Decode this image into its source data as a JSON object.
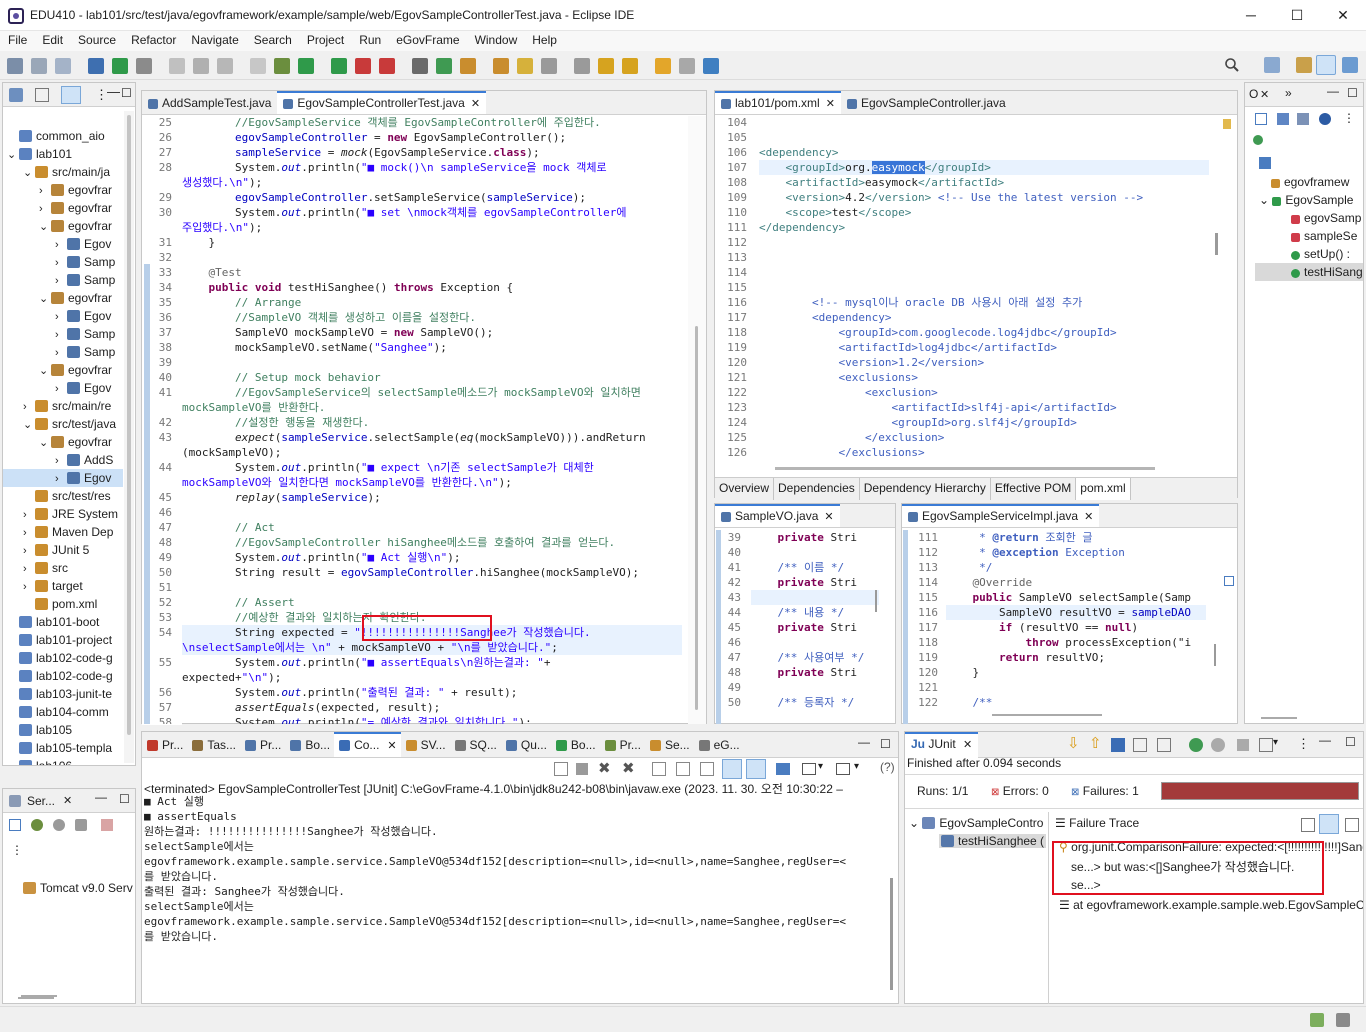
{
  "window": {
    "title": "EDU410 - lab101/src/test/java/egovframework/example/sample/web/EgovSampleControllerTest.java - Eclipse IDE",
    "minimize": "─",
    "maximize": "☐",
    "close": "✕"
  },
  "menu": [
    "File",
    "Edit",
    "Source",
    "Refactor",
    "Navigate",
    "Search",
    "Project",
    "Run",
    "eGovFrame",
    "Window",
    "Help"
  ],
  "explorer": {
    "items": [
      {
        "label": "common_aio",
        "indent": 0,
        "arrow": ""
      },
      {
        "label": "lab101",
        "indent": 0,
        "arrow": "⌄"
      },
      {
        "label": "src/main/ja",
        "indent": 1,
        "arrow": "⌄"
      },
      {
        "label": "egovfrar",
        "indent": 2,
        "arrow": "›"
      },
      {
        "label": "egovfrar",
        "indent": 2,
        "arrow": "›"
      },
      {
        "label": "egovfrar",
        "indent": 2,
        "arrow": "⌄"
      },
      {
        "label": "Egov",
        "indent": 3,
        "arrow": "›"
      },
      {
        "label": "Samp",
        "indent": 3,
        "arrow": "›"
      },
      {
        "label": "Samp",
        "indent": 3,
        "arrow": "›"
      },
      {
        "label": "egovfrar",
        "indent": 2,
        "arrow": "⌄"
      },
      {
        "label": "Egov",
        "indent": 3,
        "arrow": "›"
      },
      {
        "label": "Samp",
        "indent": 3,
        "arrow": "›"
      },
      {
        "label": "Samp",
        "indent": 3,
        "arrow": "›"
      },
      {
        "label": "egovfrar",
        "indent": 2,
        "arrow": "⌄"
      },
      {
        "label": "Egov",
        "indent": 3,
        "arrow": "›"
      },
      {
        "label": "src/main/re",
        "indent": 1,
        "arrow": "›"
      },
      {
        "label": "src/test/java",
        "indent": 1,
        "arrow": "⌄"
      },
      {
        "label": "egovfrar",
        "indent": 2,
        "arrow": "⌄"
      },
      {
        "label": "AddS",
        "indent": 3,
        "arrow": "›"
      },
      {
        "label": "Egov",
        "indent": 3,
        "arrow": "›"
      },
      {
        "label": "src/test/res",
        "indent": 1,
        "arrow": ""
      },
      {
        "label": "JRE System",
        "indent": 1,
        "arrow": "›"
      },
      {
        "label": "Maven Dep",
        "indent": 1,
        "arrow": "›"
      },
      {
        "label": "JUnit 5",
        "indent": 1,
        "arrow": "›"
      },
      {
        "label": "src",
        "indent": 1,
        "arrow": "›"
      },
      {
        "label": "target",
        "indent": 1,
        "arrow": "›"
      },
      {
        "label": "pom.xml",
        "indent": 1,
        "arrow": ""
      },
      {
        "label": "lab101-boot",
        "indent": 0,
        "arrow": ""
      },
      {
        "label": "lab101-project",
        "indent": 0,
        "arrow": ""
      },
      {
        "label": "lab102-code-g",
        "indent": 0,
        "arrow": ""
      },
      {
        "label": "lab102-code-g",
        "indent": 0,
        "arrow": ""
      },
      {
        "label": "lab103-junit-te",
        "indent": 0,
        "arrow": ""
      },
      {
        "label": "lab104-comm",
        "indent": 0,
        "arrow": ""
      },
      {
        "label": "lab105",
        "indent": 0,
        "arrow": ""
      },
      {
        "label": "lab105-templa",
        "indent": 0,
        "arrow": ""
      },
      {
        "label": "lab106",
        "indent": 0,
        "arrow": ""
      }
    ]
  },
  "servers": {
    "tab": "Ser...",
    "item": "Tomcat v9.0 Serv"
  },
  "editor": {
    "tabs": [
      {
        "label": "AddSampleTest.java",
        "active": false
      },
      {
        "label": "EgovSampleControllerTest.java",
        "active": true
      }
    ],
    "lines": [
      {
        "n": "25",
        "h": "<span class=\"cm\">        //EgovSampleService 객체를 EgovSampleController에 주입한다.</span>"
      },
      {
        "n": "26",
        "h": "        <span class=\"fd\">egovSampleController</span> = <span class=\"kw\">new</span> EgovSampleController();"
      },
      {
        "n": "27",
        "h": "        <span class=\"fd\">sampleService</span> = <span class=\"it\">mock</span>(EgovSampleService.<span class=\"kw\">class</span>);"
      },
      {
        "n": "28",
        "h": "        System.<span class=\"fd it\">out</span>.println(<span class=\"st\">\"■ mock()\\n sampleService을 mock 객체로</span>"
      },
      {
        "n": "",
        "h": "<span class=\"st\">생성했다.\\n\"</span>);"
      },
      {
        "n": "29",
        "h": "        <span class=\"fd\">egovSampleController</span>.setSampleService(<span class=\"fd\">sampleService</span>);"
      },
      {
        "n": "30",
        "h": "        System.<span class=\"fd it\">out</span>.println(<span class=\"st\">\"■ set \\nmock객체를 egovSampleController에</span>"
      },
      {
        "n": "",
        "h": "<span class=\"st\">주입했다.\\n\"</span>);"
      },
      {
        "n": "31",
        "h": "    }"
      },
      {
        "n": "32",
        "h": ""
      },
      {
        "n": "33",
        "h": "    <span class=\"ann\">@Test</span>"
      },
      {
        "n": "34",
        "h": "    <span class=\"kw\">public void</span> testHiSanghee() <span class=\"kw\">throws</span> Exception {"
      },
      {
        "n": "35",
        "h": "<span class=\"cm\">        // Arrange</span>"
      },
      {
        "n": "36",
        "h": "<span class=\"cm\">        //SampleVO 객체를 생성하고 이름을 설정한다.</span>"
      },
      {
        "n": "37",
        "h": "        SampleVO mockSampleVO = <span class=\"kw\">new</span> SampleVO();"
      },
      {
        "n": "38",
        "h": "        mockSampleVO.setName(<span class=\"st\">\"Sanghee\"</span>);"
      },
      {
        "n": "39",
        "h": ""
      },
      {
        "n": "40",
        "h": "<span class=\"cm\">        // Setup mock behavior</span>"
      },
      {
        "n": "41",
        "h": "<span class=\"cm\">        //EgovSampleService의 selectSample메소드가 mockSampleVO와 일치하면</span>"
      },
      {
        "n": "",
        "h": "<span class=\"cm\">mockSampleVO를 반환한다.</span>"
      },
      {
        "n": "42",
        "h": "<span class=\"cm\">        //설정한 행동을 재생한다.</span>"
      },
      {
        "n": "43",
        "h": "        <span class=\"it\">expect</span>(<span class=\"fd\">sampleService</span>.selectSample(<span class=\"it\">eq</span>(mockSampleVO))).andReturn"
      },
      {
        "n": "",
        "h": "(mockSampleVO);"
      },
      {
        "n": "44",
        "h": "        System.<span class=\"fd it\">out</span>.println(<span class=\"st\">\"■ expect \\n기존 selectSample가 대체한</span>"
      },
      {
        "n": "",
        "h": "<span class=\"st\">mockSampleVO와 일치한다면 mockSampleVO를 반환한다.\\n\"</span>);"
      },
      {
        "n": "45",
        "h": "        <span class=\"it\">replay</span>(<span class=\"fd\">sampleService</span>);"
      },
      {
        "n": "46",
        "h": ""
      },
      {
        "n": "47",
        "h": "<span class=\"cm\">        // Act</span>"
      },
      {
        "n": "48",
        "h": "<span class=\"cm\">        //EgovSampleController hiSanghee메소드를 호출하여 결과를 얻는다.</span>"
      },
      {
        "n": "49",
        "h": "        System.<span class=\"fd it\">out</span>.println(<span class=\"st\">\"■ Act 실행\\n\"</span>);"
      },
      {
        "n": "50",
        "h": "        String result = <span class=\"fd\">egovSampleController</span>.hiSanghee(mockSampleVO);"
      },
      {
        "n": "51",
        "h": ""
      },
      {
        "n": "52",
        "h": "<span class=\"cm\">        // Assert</span>"
      },
      {
        "n": "53",
        "h": "<span class=\"cm\">        //예상한 결과와 일치하는지 확인한다.</span>"
      },
      {
        "n": "54",
        "h": "        String expected = <span class=\"st\">\"!!!!!!!!!!!!!!!Sanghee가 작성했습니다.</span>"
      },
      {
        "n": "",
        "h": "<span class=\"st\">\\nselectSample에서는 \\n\"</span> + mockSampleVO + <span class=\"st\">\"\\n를 받았습니다.\"</span>;"
      },
      {
        "n": "55",
        "h": "        System.<span class=\"fd it\">out</span>.println(<span class=\"st\">\"■ assertEquals\\n원하는결과: \"</span>+"
      },
      {
        "n": "",
        "h": "expected+<span class=\"st\">\"\\n\"</span>);"
      },
      {
        "n": "56",
        "h": "        System.<span class=\"fd it\">out</span>.println(<span class=\"st\">\"출력된 결과: \"</span> + result);"
      },
      {
        "n": "57",
        "h": "        <span class=\"it\">assertEquals</span>(expected, result);"
      },
      {
        "n": "58",
        "h": "        System.<span class=\"fd it\">out</span>.println(<span class=\"st\">\"= 예상한 결과와 일치합니다.\"</span>);"
      }
    ]
  },
  "pom": {
    "tabs": [
      {
        "label": "lab101/pom.xml",
        "active": true
      },
      {
        "label": "EgovSampleController.java",
        "active": false
      }
    ],
    "lines": [
      {
        "n": "104",
        "h": ""
      },
      {
        "n": "105",
        "h": ""
      },
      {
        "n": "106",
        "h": "<span class=\"tag\">&lt;dependency&gt;</span>"
      },
      {
        "n": "107",
        "h": "    <span class=\"tag\">&lt;groupId&gt;</span>org.<span style=\"background:#3875d7;color:#fff\">easymock</span><span class=\"tag\">&lt;/groupId&gt;</span>"
      },
      {
        "n": "108",
        "h": "    <span class=\"tag\">&lt;artifactId&gt;</span>easymock<span class=\"tag\">&lt;/artifactId&gt;</span>"
      },
      {
        "n": "109",
        "h": "    <span class=\"tag\">&lt;version&gt;</span>4.2<span class=\"tag\">&lt;/version&gt;</span> <span class=\"xcm\">&lt;!-- Use the latest version --&gt;</span>"
      },
      {
        "n": "110",
        "h": "    <span class=\"tag\">&lt;scope&gt;</span>test<span class=\"tag\">&lt;/scope&gt;</span>"
      },
      {
        "n": "111",
        "h": "<span class=\"tag\">&lt;/dependency&gt;</span>"
      },
      {
        "n": "112",
        "h": ""
      },
      {
        "n": "113",
        "h": ""
      },
      {
        "n": "114",
        "h": ""
      },
      {
        "n": "115",
        "h": ""
      },
      {
        "n": "116",
        "h": "        <span class=\"xcm\">&lt;!-- mysql이나 oracle DB 사용시 아래 설정 추가</span>"
      },
      {
        "n": "117",
        "h": "<span class=\"xcm\">        &lt;dependency&gt;</span>"
      },
      {
        "n": "118",
        "h": "<span class=\"xcm\">            &lt;groupId&gt;com.googlecode.log4jdbc&lt;/groupId&gt;</span>"
      },
      {
        "n": "119",
        "h": "<span class=\"xcm\">            &lt;artifactId&gt;log4jdbc&lt;/artifactId&gt;</span>"
      },
      {
        "n": "120",
        "h": "<span class=\"xcm\">            &lt;version&gt;1.2&lt;/version&gt;</span>"
      },
      {
        "n": "121",
        "h": "<span class=\"xcm\">            &lt;exclusions&gt;</span>"
      },
      {
        "n": "122",
        "h": "<span class=\"xcm\">                &lt;exclusion&gt;</span>"
      },
      {
        "n": "123",
        "h": "<span class=\"xcm\">                    &lt;artifactId&gt;slf4j-api&lt;/artifactId&gt;</span>"
      },
      {
        "n": "124",
        "h": "<span class=\"xcm\">                    &lt;groupId&gt;org.slf4j&lt;/groupId&gt;</span>"
      },
      {
        "n": "125",
        "h": "<span class=\"xcm\">                &lt;/exclusion&gt;</span>"
      },
      {
        "n": "126",
        "h": "<span class=\"xcm\">            &lt;/exclusions&gt;</span>"
      }
    ],
    "bottomTabs": [
      "Overview",
      "Dependencies",
      "Dependency Hierarchy",
      "Effective POM",
      "pom.xml"
    ]
  },
  "samplevo": {
    "tab": "SampleVO.java",
    "lines": [
      {
        "n": "39",
        "h": "    <span class=\"kw\">private</span> Stri"
      },
      {
        "n": "40",
        "h": ""
      },
      {
        "n": "41",
        "h": "    <span class=\"xcm\">/** 이름 */</span>"
      },
      {
        "n": "42",
        "h": "    <span class=\"kw\">private</span> Stri"
      },
      {
        "n": "43",
        "h": ""
      },
      {
        "n": "44",
        "h": "    <span class=\"xcm\">/** 내용 */</span>"
      },
      {
        "n": "45",
        "h": "    <span class=\"kw\">private</span> Stri"
      },
      {
        "n": "46",
        "h": ""
      },
      {
        "n": "47",
        "h": "    <span class=\"xcm\">/** 사용여부 */</span>"
      },
      {
        "n": "48",
        "h": "    <span class=\"kw\">private</span> Stri"
      },
      {
        "n": "49",
        "h": ""
      },
      {
        "n": "50",
        "h": "    <span class=\"xcm\">/** 등록자 */</span>"
      }
    ]
  },
  "serviceimpl": {
    "tab": "EgovSampleServiceImpl.java",
    "lines": [
      {
        "n": "111",
        "h": "     <span class=\"xcm\">* <b>@return</b> 조회한 글</span>"
      },
      {
        "n": "112",
        "h": "     <span class=\"xcm\">* <b>@exception</b> Exception</span>"
      },
      {
        "n": "113",
        "h": "     <span class=\"xcm\">*/</span>"
      },
      {
        "n": "114",
        "h": "    <span class=\"ann\">@Override</span>"
      },
      {
        "n": "115",
        "h": "    <span class=\"kw\">public</span> SampleVO selectSample(Samp"
      },
      {
        "n": "116",
        "h": "        SampleVO resultVO = <span class=\"fd\">sampleDAO</span>"
      },
      {
        "n": "117",
        "h": "        <span class=\"kw\">if</span> (resultVO == <span class=\"kw\">null</span>)"
      },
      {
        "n": "118",
        "h": "            <span class=\"kw\">throw</span> processException(\"i"
      },
      {
        "n": "119",
        "h": "        <span class=\"kw\">return</span> resultVO;"
      },
      {
        "n": "120",
        "h": "    }"
      },
      {
        "n": "121",
        "h": ""
      },
      {
        "n": "122",
        "h": "    <span class=\"xcm\">/**</span>"
      }
    ]
  },
  "outline": {
    "items": [
      {
        "label": "egovframew",
        "indent": 1
      },
      {
        "label": "EgovSample",
        "indent": 0
      },
      {
        "label": "egovSamp",
        "indent": 2
      },
      {
        "label": "sampleSe",
        "indent": 2
      },
      {
        "label": "setUp() :",
        "indent": 2
      },
      {
        "label": "testHiSang",
        "indent": 2
      }
    ]
  },
  "console": {
    "tabs": [
      "Pr...",
      "Tas...",
      "Pr...",
      "Bo...",
      "Co...",
      "SV...",
      "SQ...",
      "Qu...",
      "Bo...",
      "Pr...",
      "Se...",
      "eG..."
    ],
    "header": "<terminated> EgovSampleControllerTest [JUnit] C:\\eGovFrame-4.1.0\\bin\\jdk8u242-b08\\bin\\javaw.exe  (2023. 11. 30. 오전 10:30:22 –",
    "lines": [
      "■ Act 실행",
      "",
      "■ assertEquals",
      "원하는결과: !!!!!!!!!!!!!!!Sanghee가 작성했습니다.",
      "selectSample에서는",
      "egovframework.example.sample.service.SampleVO@534df152[description=<null>,id=<null>,name=Sanghee,regUser=<",
      "를 받았습니다.",
      "",
      "출력된 결과: Sanghee가 작성했습니다.",
      "selectSample에서는",
      "egovframework.example.sample.service.SampleVO@534df152[description=<null>,id=<null>,name=Sanghee,regUser=<",
      "를 받았습니다."
    ]
  },
  "junit": {
    "tab": "JUnit",
    "finished": "Finished after 0.094 seconds",
    "runs_label": "Runs:",
    "runs": "1/1",
    "errors_label": "Errors:",
    "errors": "0",
    "failures_label": "Failures:",
    "failures": "1",
    "failure_color": "#a33a3a",
    "progress": 1.0,
    "tree": [
      "EgovSampleContro",
      "testHiSanghee ("
    ],
    "trace_title": "Failure Trace",
    "trace": [
      "org.junit.ComparisonFailure: expected:<[!!!!!!!!!!!!!!!]Sang",
      "se...> but was:<[]Sanghee가 작성했습니다.",
      "se...>",
      "at egovframework.example.sample.web.EgovSampleC"
    ]
  }
}
